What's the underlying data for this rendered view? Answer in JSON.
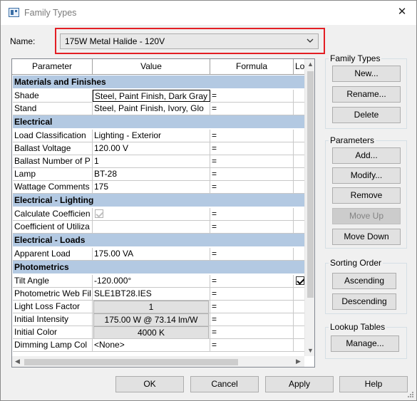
{
  "window": {
    "title": "Family Types",
    "close_glyph": "✕"
  },
  "name_field": {
    "label": "Name:",
    "value": "175W Metal Halide - 120V"
  },
  "table": {
    "headers": [
      "Parameter",
      "Value",
      "Formula",
      "Lo"
    ],
    "groups": [
      {
        "name": "Materials and Finishes",
        "rows": [
          {
            "param": "Shade",
            "value": "Steel, Paint Finish, Dark Gray",
            "formula": "=",
            "kind": "selected"
          },
          {
            "param": "Stand",
            "value": "Steel, Paint Finish, Ivory, Glo",
            "formula": "=",
            "kind": "text"
          }
        ]
      },
      {
        "name": "Electrical",
        "rows": [
          {
            "param": "Load Classification",
            "value": "Lighting - Exterior",
            "formula": "=",
            "kind": "text"
          },
          {
            "param": "Ballast Voltage",
            "value": "120.00 V",
            "formula": "=",
            "kind": "text"
          },
          {
            "param": "Ballast Number of P",
            "value": "1",
            "formula": "=",
            "kind": "text"
          },
          {
            "param": "Lamp",
            "value": "BT-28",
            "formula": "=",
            "kind": "text"
          },
          {
            "param": "Wattage Comments",
            "value": "175",
            "formula": "=",
            "kind": "text"
          }
        ]
      },
      {
        "name": "Electrical - Lighting",
        "rows": [
          {
            "param": "Calculate Coefficien",
            "value": "",
            "formula": "=",
            "kind": "checkbox",
            "checked": true
          },
          {
            "param": "Coefficient of Utiliza",
            "value": "",
            "formula": "=",
            "kind": "text"
          }
        ]
      },
      {
        "name": "Electrical - Loads",
        "rows": [
          {
            "param": "Apparent Load",
            "value": "175.00 VA",
            "formula": "=",
            "kind": "text"
          }
        ]
      },
      {
        "name": "Photometrics",
        "rows": [
          {
            "param": "Tilt Angle",
            "value": "-120.000°",
            "formula": "=",
            "kind": "text",
            "lock_checked": true
          },
          {
            "param": "Photometric Web Fil",
            "value": "SLE1BT28.IES",
            "formula": "=",
            "kind": "text"
          },
          {
            "param": "Light Loss Factor",
            "value": "1",
            "formula": "=",
            "kind": "button"
          },
          {
            "param": "Initial Intensity",
            "value": "175.00 W @ 73.14 lm/W",
            "formula": "=",
            "kind": "button"
          },
          {
            "param": "Initial Color",
            "value": "4000 K",
            "formula": "=",
            "kind": "button"
          },
          {
            "param": "Dimming Lamp Col",
            "value": "<None>",
            "formula": "=",
            "kind": "text"
          }
        ]
      }
    ]
  },
  "panels": {
    "family_types": {
      "label": "Family Types",
      "new": "New...",
      "rename": "Rename...",
      "delete": "Delete"
    },
    "parameters": {
      "label": "Parameters",
      "add": "Add...",
      "modify": "Modify...",
      "remove": "Remove",
      "move_up": "Move Up",
      "move_down": "Move Down"
    },
    "sorting": {
      "label": "Sorting Order",
      "ascending": "Ascending",
      "descending": "Descending"
    },
    "lookup": {
      "label": "Lookup Tables",
      "manage": "Manage..."
    }
  },
  "footer": {
    "ok": "OK",
    "cancel": "Cancel",
    "apply": "Apply",
    "help": "Help"
  },
  "colors": {
    "group_header": "#b3c9e2",
    "highlight_border": "#e31e24",
    "window_bg": "#f0f0f0"
  }
}
